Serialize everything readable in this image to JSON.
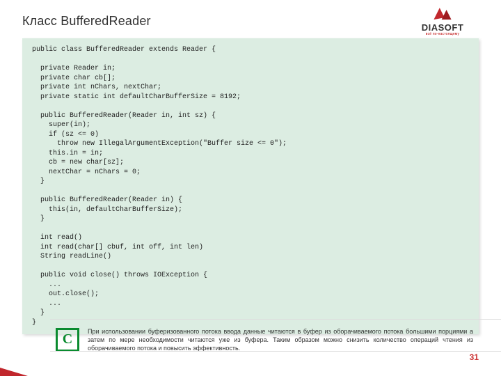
{
  "title": "Класс BufferedReader",
  "brand": {
    "name": "DIASOFT",
    "tagline": "всё по-настоящему"
  },
  "code": "public class BufferedReader extends Reader {\n\n  private Reader in;\n  private char cb[];\n  private int nChars, nextChar;\n  private static int defaultCharBufferSize = 8192;\n\n  public BufferedReader(Reader in, int sz) {\n    super(in);\n    if (sz <= 0)\n      throw new IllegalArgumentException(\"Buffer size <= 0\");\n    this.in = in;\n    cb = new char[sz];\n    nextChar = nChars = 0;\n  }\n\n  public BufferedReader(Reader in) {\n    this(in, defaultCharBufferSize);\n  }\n\n  int read()\n  int read(char[] cbuf, int off, int len)\n  String readLine()\n\n  public void close() throws IOException {\n    ...\n    out.close();\n    ...\n  }\n}",
  "callout": {
    "badge": "С",
    "text": "При использовании буферизованного потока ввода данные читаются в буфер из оборачиваемого потока большими порциями а затем по мере необходимости читаются уже из буфера. Таким образом можно снизить количество операций чтения из  оборачиваемого потока и повысить эффективность."
  },
  "page": "31"
}
